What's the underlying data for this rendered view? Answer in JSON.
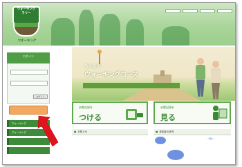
{
  "header": {
    "logo_badge_text": "ウォーキング\nラリー",
    "logo_caption": "ウオーキング",
    "links": [
      "",
      "",
      "",
      ""
    ]
  },
  "sidebar": {
    "login_title": "ログイン",
    "field_labels": [
      "",
      ""
    ],
    "login_button": "ログイン",
    "links": [
      "",
      ""
    ],
    "register_button": "",
    "menu": [
      "ウォーキング",
      "ウォーキング",
      "",
      ""
    ]
  },
  "hero": {
    "line1": "みんなで",
    "line2": "ウォーキングコース",
    "tagline": ""
  },
  "actions": {
    "record": {
      "small": "歩数記録を",
      "big": "つける",
      "icon": "notebook-icon"
    },
    "view": {
      "small": "歩数記録を",
      "big": "見る",
      "icon": "person-icon"
    }
  },
  "sections": {
    "left_title": "お知らせ",
    "right_title": "参加者の状況",
    "more": "一覧へ"
  },
  "colors": {
    "brand_green": "#3e8c3a",
    "header_green": "#a9d59a",
    "accent_orange": "#f2a860",
    "arrow_red": "#e0141e",
    "dot_blue": "#7090e0"
  }
}
